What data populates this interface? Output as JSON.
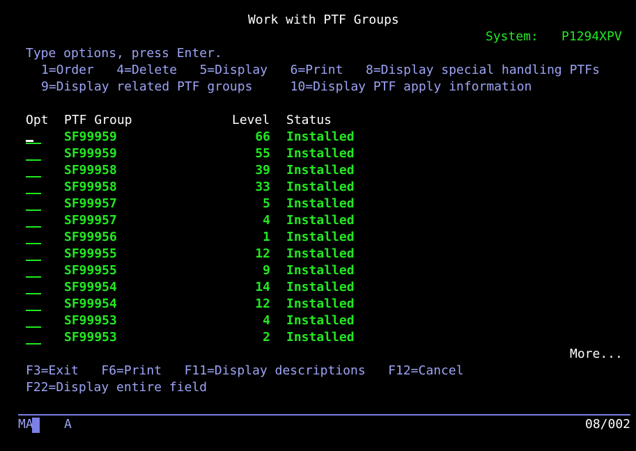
{
  "header": {
    "title": "Work with PTF Groups",
    "system_label": "System:",
    "system_name": "P1294XPV"
  },
  "instructions": {
    "prompt": "Type options, press Enter.",
    "options_line1": "1=Order   4=Delete   5=Display   6=Print   8=Display special handling PTFs",
    "options_line2": "9=Display related PTF groups     10=Display PTF apply information"
  },
  "columns": {
    "opt": "Opt",
    "group": "PTF Group",
    "level": "Level",
    "status": "Status"
  },
  "rows": [
    {
      "group": "SF99959",
      "level": "66",
      "status": "Installed"
    },
    {
      "group": "SF99959",
      "level": "55",
      "status": "Installed"
    },
    {
      "group": "SF99958",
      "level": "39",
      "status": "Installed"
    },
    {
      "group": "SF99958",
      "level": "33",
      "status": "Installed"
    },
    {
      "group": "SF99957",
      "level": "5",
      "status": "Installed"
    },
    {
      "group": "SF99957",
      "level": "4",
      "status": "Installed"
    },
    {
      "group": "SF99956",
      "level": "1",
      "status": "Installed"
    },
    {
      "group": "SF99955",
      "level": "12",
      "status": "Installed"
    },
    {
      "group": "SF99955",
      "level": "9",
      "status": "Installed"
    },
    {
      "group": "SF99954",
      "level": "14",
      "status": "Installed"
    },
    {
      "group": "SF99954",
      "level": "12",
      "status": "Installed"
    },
    {
      "group": "SF99953",
      "level": "4",
      "status": "Installed"
    },
    {
      "group": "SF99953",
      "level": "2",
      "status": "Installed"
    }
  ],
  "more_indicator": "More...",
  "function_keys": {
    "line1": "F3=Exit   F6=Print   F11=Display descriptions   F12=Cancel",
    "line2": "F22=Display entire field"
  },
  "status_bar": {
    "left_a": "MA",
    "left_b": "A",
    "cursor_position": "08/002"
  },
  "colors": {
    "background": "#000000",
    "field_text": "#22e822",
    "label_text": "#9da4f5",
    "title_text": "#ffffff"
  }
}
